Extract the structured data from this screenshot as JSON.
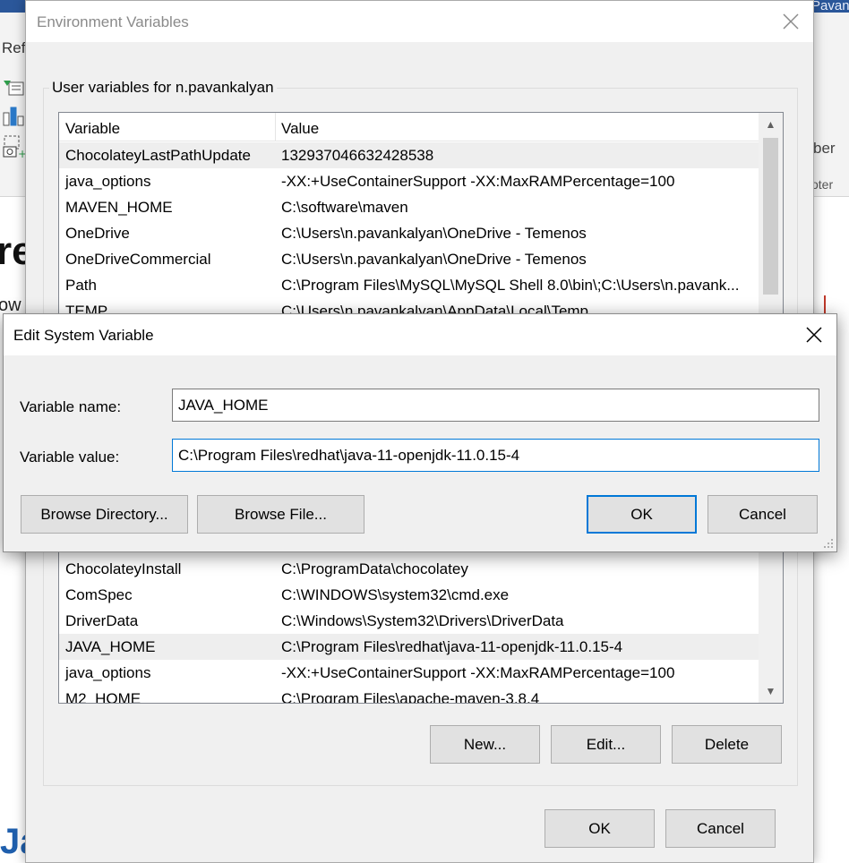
{
  "background": {
    "ribbon_ref": "Ref",
    "ribbon_ber": "ber",
    "ribbon_oter": "oter",
    "user_fragment": "Pavan",
    "heading_fragment": "re",
    "text_fragment": "ow",
    "bottom_fragment": "Ja"
  },
  "env_dialog": {
    "title": "Environment Variables",
    "user_group_label": "User variables for n.pavankalyan",
    "columns": {
      "variable": "Variable",
      "value": "Value"
    },
    "user_vars": [
      {
        "name": "ChocolateyLastPathUpdate",
        "value": "132937046632428538",
        "selected": true
      },
      {
        "name": "java_options",
        "value": "-XX:+UseContainerSupport -XX:MaxRAMPercentage=100"
      },
      {
        "name": "MAVEN_HOME",
        "value": "C:\\software\\maven"
      },
      {
        "name": "OneDrive",
        "value": "C:\\Users\\n.pavankalyan\\OneDrive - Temenos"
      },
      {
        "name": "OneDriveCommercial",
        "value": "C:\\Users\\n.pavankalyan\\OneDrive - Temenos"
      },
      {
        "name": "Path",
        "value": "C:\\Program Files\\MySQL\\MySQL Shell 8.0\\bin\\;C:\\Users\\n.pavank..."
      },
      {
        "name": "TEMP",
        "value": "C:\\Users\\n.pavankalyan\\AppData\\Local\\Temp"
      }
    ],
    "system_vars": [
      {
        "name": "ChocolateyInstall",
        "value": "C:\\ProgramData\\chocolatey"
      },
      {
        "name": "ComSpec",
        "value": "C:\\WINDOWS\\system32\\cmd.exe"
      },
      {
        "name": "DriverData",
        "value": "C:\\Windows\\System32\\Drivers\\DriverData"
      },
      {
        "name": "JAVA_HOME",
        "value": "C:\\Program Files\\redhat\\java-11-openjdk-11.0.15-4",
        "selected": true
      },
      {
        "name": "java_options",
        "value": "-XX:+UseContainerSupport -XX:MaxRAMPercentage=100"
      },
      {
        "name": "M2_HOME",
        "value": "C:\\Program Files\\apache-maven-3.8.4"
      }
    ],
    "buttons": {
      "new": "New...",
      "edit": "Edit...",
      "delete": "Delete",
      "ok": "OK",
      "cancel": "Cancel"
    }
  },
  "edit_dialog": {
    "title": "Edit System Variable",
    "name_label": "Variable name:",
    "name_value": "JAVA_HOME",
    "value_label": "Variable value:",
    "value_value": "C:\\Program Files\\redhat\\java-11-openjdk-11.0.15-4",
    "buttons": {
      "browse_dir": "Browse Directory...",
      "browse_file": "Browse File...",
      "ok": "OK",
      "cancel": "Cancel"
    }
  },
  "colors": {
    "accent": "#0078d7",
    "dialog_bg": "#f0f0f0",
    "button_bg": "#e1e1e1",
    "word_blue": "#2b579a"
  }
}
